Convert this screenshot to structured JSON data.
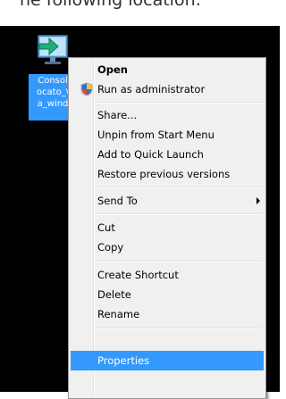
{
  "top_strip": {
    "text": "he following location:"
  },
  "desktop_icon": {
    "name": "console-shortcut-icon",
    "label_lines": [
      "Consol",
      "ocato_\\",
      "a_wind"
    ]
  },
  "context_menu": {
    "open_label": "Open",
    "run_as_admin_label": "Run as administrator",
    "share_label": "Share...",
    "unpin_label": "Unpin from Start Menu",
    "add_quick_launch_label": "Add to Quick Launch",
    "restore_label": "Restore previous versions",
    "send_to_label": "Send To",
    "cut_label": "Cut",
    "copy_label": "Copy",
    "create_shortcut_label": "Create Shortcut",
    "delete_label": "Delete",
    "rename_label": "Rename",
    "properties_label": "Properties",
    "highlighted_item": "Properties",
    "highlight_color": "#3399ff",
    "shield_icon": "uac-shield-icon",
    "submenu_icon": "chevron-right-icon"
  }
}
